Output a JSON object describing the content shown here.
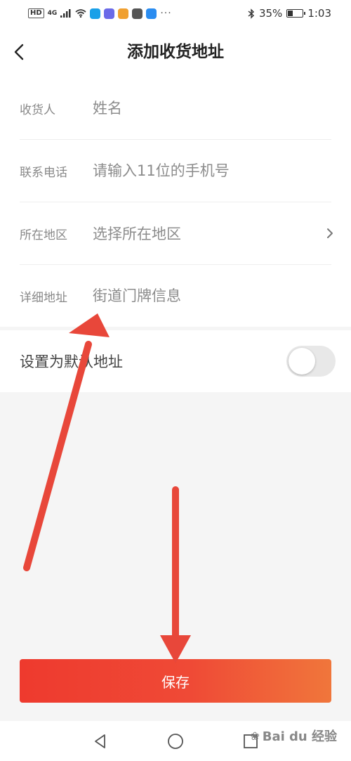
{
  "status_bar": {
    "hd": "HD",
    "network": "4G",
    "battery_percent": "35%",
    "battery_level": 0.35,
    "time": "1:03",
    "dots": "···",
    "app_icon_colors": [
      "#1aa0e8",
      "#6a6ae8",
      "#f0a030",
      "#555555",
      "#2a8cf0"
    ]
  },
  "header": {
    "title": "添加收货地址"
  },
  "form": {
    "rows": [
      {
        "label": "收货人",
        "placeholder": "姓名"
      },
      {
        "label": "联系电话",
        "placeholder": "请输入11位的手机号"
      },
      {
        "label": "所在地区",
        "value": "选择所在地区"
      },
      {
        "label": "详细地址",
        "placeholder": "街道门牌信息"
      }
    ]
  },
  "default_address": {
    "label": "设置为默认地址",
    "enabled": false
  },
  "save_button": {
    "label": "保存"
  },
  "watermark": {
    "text": "Bai du 经验"
  },
  "colors": {
    "accent_start": "#ee3a2e",
    "accent_end": "#f0763b",
    "annotation_arrow": "#e8473a"
  }
}
